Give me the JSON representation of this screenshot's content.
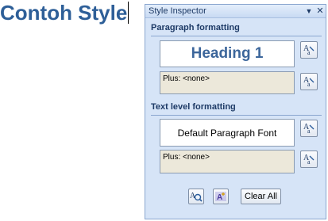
{
  "document": {
    "heading_text": "Contoh Style"
  },
  "pane": {
    "title": "Style Inspector",
    "dropdown_icon": "chevron-down-icon",
    "close_icon": "close-icon",
    "paragraph_section": {
      "header": "Paragraph formatting",
      "style_name": "Heading 1",
      "plus_text": "Plus: <none>"
    },
    "text_section": {
      "header": "Text level formatting",
      "style_name": "Default Paragraph Font",
      "plus_text": "Plus: <none>"
    },
    "buttons": {
      "clear_all": "Clear All",
      "reveal_formatting_icon": "reveal-formatting-icon",
      "new_style_icon": "new-style-icon",
      "reset_icon": "reset-format-icon"
    }
  },
  "colors": {
    "heading": "#2e5f98",
    "pane_bg": "#d6e4f7",
    "section_header": "#1d3a66",
    "beige_box": "#ece8da"
  }
}
